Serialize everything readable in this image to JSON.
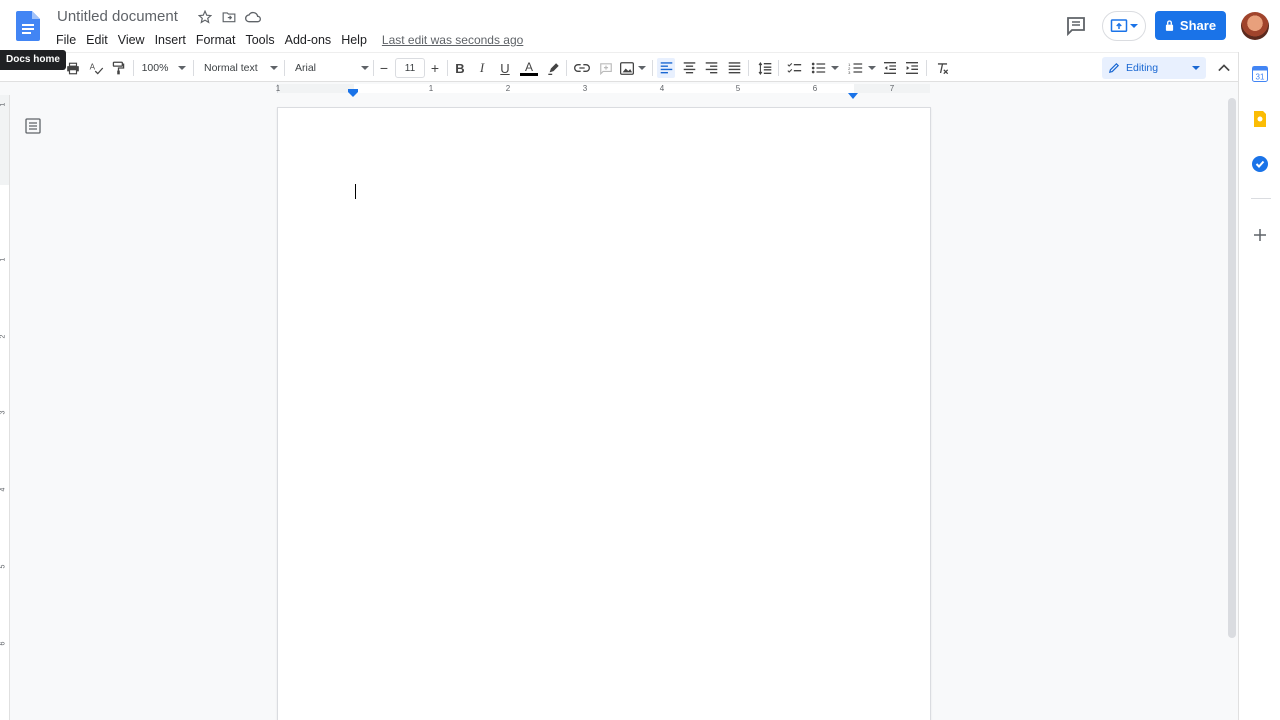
{
  "document": {
    "title": "Untitled document",
    "last_edit": "Last edit was seconds ago"
  },
  "tooltip": "Docs home",
  "menu": [
    "File",
    "Edit",
    "View",
    "Insert",
    "Format",
    "Tools",
    "Add-ons",
    "Help"
  ],
  "header": {
    "share_label": "Share"
  },
  "toolbar": {
    "zoom": "100%",
    "style": "Normal text",
    "font": "Arial",
    "font_size": "11",
    "mode": "Editing"
  },
  "ruler": {
    "numbers": [
      "1",
      "1",
      "2",
      "3",
      "4",
      "5",
      "6",
      "7"
    ]
  },
  "vruler": {
    "numbers": [
      "1",
      "1",
      "2",
      "3",
      "4",
      "5",
      "6"
    ]
  },
  "side_panel": {
    "calendar_label": "31"
  },
  "colors": {
    "accent": "#1a73e8",
    "editing_bg": "#e8f0fe",
    "keep_yellow": "#fbbc04",
    "tasks_blue": "#1967d2"
  }
}
